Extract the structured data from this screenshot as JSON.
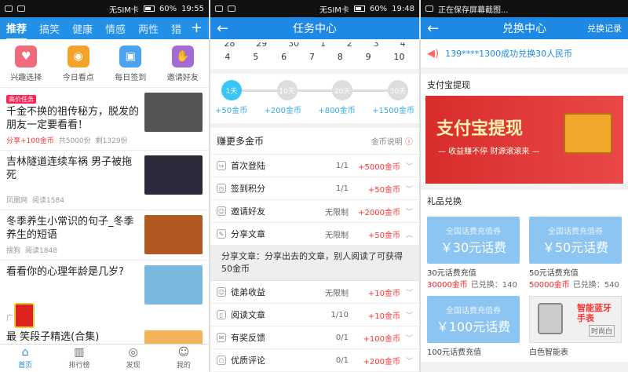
{
  "panel1": {
    "status": {
      "carrier": "无SIM卡",
      "battery": "60%",
      "time": "19:55"
    },
    "tabs": [
      "推荐",
      "搞笑",
      "健康",
      "情感",
      "两性",
      "猎"
    ],
    "quick": [
      {
        "label": "兴趣选择",
        "icon": "heart-icon",
        "color": "#f06c7a"
      },
      {
        "label": "今日看点",
        "icon": "eye-icon",
        "color": "#f4a32a"
      },
      {
        "label": "每日签到",
        "icon": "calendar-icon",
        "color": "#4aa3f0"
      },
      {
        "label": "邀请好友",
        "icon": "handshake-icon",
        "color": "#a36bd6"
      }
    ],
    "news": [
      {
        "badge": "高价任务",
        "title": "千金不换的祖传秘方，脱发的朋友一定要看看！",
        "share": "分享+100金币",
        "total": "共5000份",
        "left": "剩1329份",
        "thumbColor": "#555"
      },
      {
        "title": "吉林隧道连续车祸 男子被拖死",
        "source": "凤凰网",
        "reads": "阅读1584",
        "thumbColor": "#2a2a3a"
      },
      {
        "title": "冬季养生小常识的句子_冬季养生的短语",
        "source": "搜狗",
        "reads": "阅读1848",
        "thumbColor": "#b05a22"
      },
      {
        "title": "看看你的心理年龄是几岁?",
        "thumbColor": "#7ab8e0"
      }
    ],
    "ad_label": "广告",
    "last_title": "最 笑段子精选(合集)",
    "bottom": [
      "首页",
      "排行榜",
      "发现",
      "我的"
    ]
  },
  "panel2": {
    "status": {
      "carrier": "无SIM卡",
      "battery": "60%",
      "time": "19:48"
    },
    "title": "任务中心",
    "cal_top": [
      "28",
      "29",
      "30",
      "1",
      "2",
      "3",
      "4"
    ],
    "cal_row": [
      "4",
      "5",
      "6",
      "7",
      "8",
      "9",
      "10"
    ],
    "days": [
      "1天",
      "10天",
      "20天",
      "30天"
    ],
    "rewards": [
      "+50金币",
      "+200金币",
      "+800金币",
      "+1500金币"
    ],
    "section": "赚更多金币",
    "explain": "金币说明",
    "tasks": [
      {
        "name": "首次登陆",
        "limit": "1/1",
        "reward": "+5000金币",
        "chev": "﹀"
      },
      {
        "name": "签到积分",
        "limit": "1/1",
        "reward": "+50金币",
        "chev": "﹀"
      },
      {
        "name": "邀请好友",
        "limit": "无限制",
        "reward": "+2000金币",
        "chev": "﹀"
      },
      {
        "name": "分享文章",
        "limit": "无限制",
        "reward": "+50金币",
        "chev": "︿"
      }
    ],
    "expand_text": "分享文章：分享出去的文章，别人阅读了可获得50金币",
    "tasks2": [
      {
        "name": "徒弟收益",
        "limit": "无限制",
        "reward": "+10金币",
        "chev": "﹀"
      },
      {
        "name": "阅读文章",
        "limit": "1/10",
        "reward": "+10金币",
        "chev": "﹀"
      },
      {
        "name": "有奖反馈",
        "limit": "0/1",
        "reward": "+100金币",
        "chev": "﹀"
      },
      {
        "name": "优质评论",
        "limit": "0/1",
        "reward": "+200金币",
        "chev": "﹀"
      }
    ]
  },
  "panel3": {
    "status_text": "正在保存屏幕截图...",
    "title": "兑换中心",
    "record": "兑换记录",
    "marquee": "139****1300成功兑换30人民币",
    "alipay_section": "支付宝提现",
    "banner_big": "支付宝提现",
    "banner_small": "— 收益赚不停 财源滚滚来 —",
    "gift_section": "礼品兑换",
    "gifts": [
      {
        "voucher_sub": "全国话费充值券",
        "voucher_amt": "￥30元话费",
        "name": "30元话费充值",
        "price": "30000金币",
        "exchanged": "已兑换：140"
      },
      {
        "voucher_sub": "全国话费充值券",
        "voucher_amt": "￥50元话费",
        "name": "50元话费充值",
        "price": "50000金币",
        "exchanged": "已兑换：540"
      },
      {
        "voucher_sub": "全国话费充值券",
        "voucher_amt": "￥100元话费",
        "name": "100元话费充值"
      },
      {
        "watch_title": "智能蓝牙手表",
        "watch_tag": "时尚白",
        "name": "白色智能表"
      }
    ]
  }
}
